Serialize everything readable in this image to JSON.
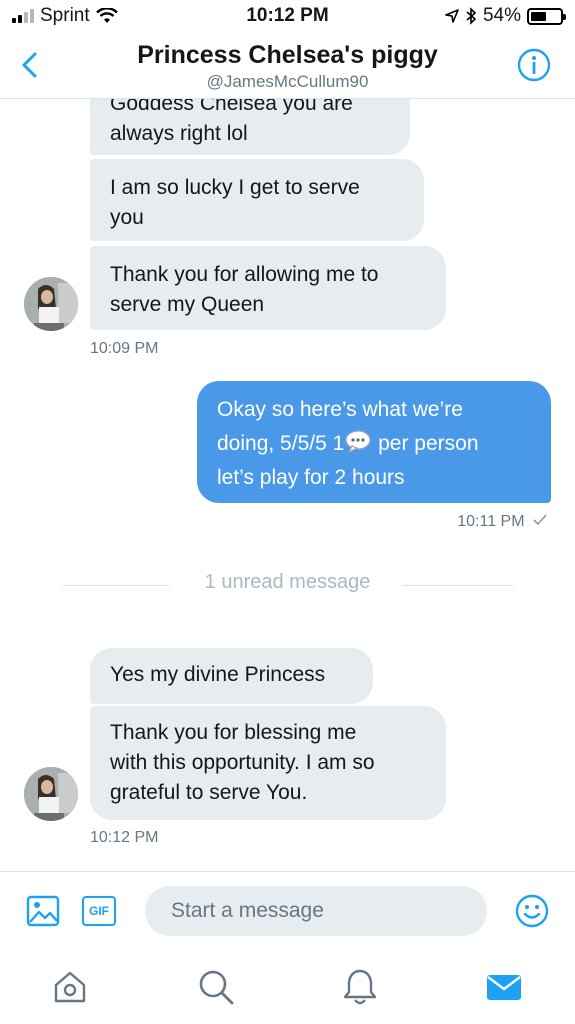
{
  "status_bar": {
    "carrier": "Sprint",
    "time": "10:12 PM",
    "battery": "54%",
    "battery_level": 0.54
  },
  "header": {
    "title": "Princess Chelsea's piggy",
    "handle": "@JamesMcCullum90"
  },
  "messages": {
    "m1_line1": "Goddess Chelsea you are",
    "m1_line2": "always right lol",
    "m2_line1": "I am so lucky I get to serve",
    "m2_line2": "you",
    "m3_line1": "Thank you for allowing me to",
    "m3_line2": "serve my Queen",
    "time1": "10:09 PM",
    "out_line1": "Okay so here’s what we’re",
    "out_line2a": "doing, 5/5/5 1",
    "out_line2b": " per person",
    "out_line3": "let’s play for 2 hours",
    "time2": "10:11 PM",
    "unread": "1 unread message",
    "m4": "Yes my divine Princess",
    "m5_line1": "Thank you for blessing me",
    "m5_line2": "with this opportunity. I am so",
    "m5_line3": "grateful to serve You.",
    "time3": "10:12 PM"
  },
  "composer": {
    "placeholder": "Start a message",
    "gif_label": "GIF"
  },
  "colors": {
    "accent": "#1da1f2",
    "outgoing_bubble": "#4a99e9",
    "incoming_bubble": "#e6ecf0"
  },
  "icons": [
    "back-chevron-icon",
    "info-icon",
    "image-icon",
    "gif-icon",
    "emoji-icon",
    "home-icon",
    "search-icon",
    "notifications-icon",
    "messages-icon",
    "speech-bubble-emoji-icon"
  ]
}
